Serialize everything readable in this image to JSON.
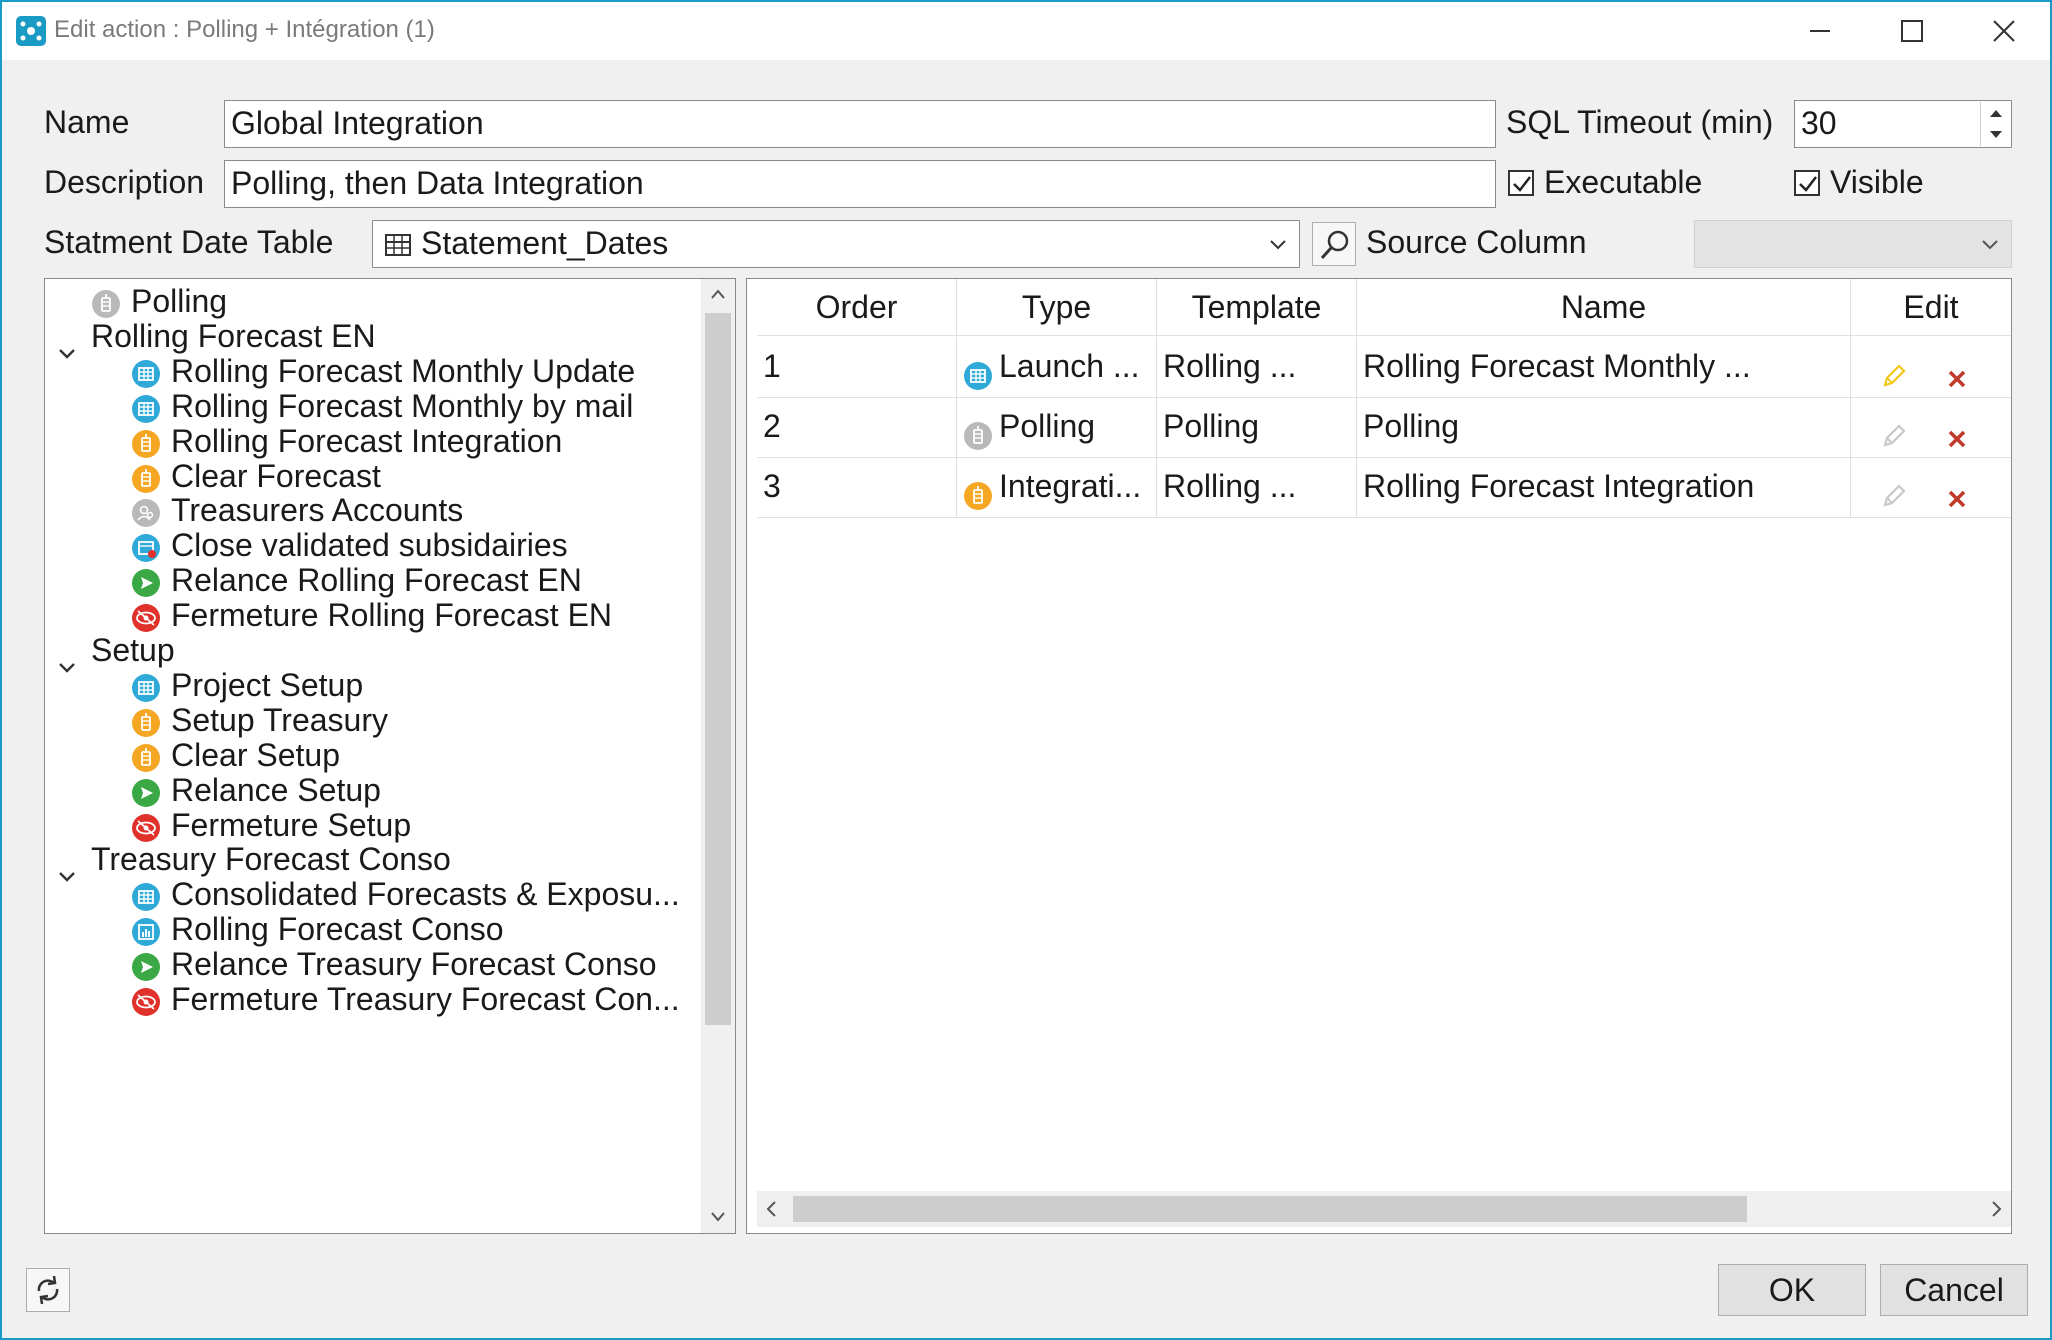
{
  "window": {
    "title": "Edit action : Polling + Intégration (1)"
  },
  "form": {
    "name_label": "Name",
    "name_value": "Global Integration",
    "sql_timeout_label": "SQL Timeout (min)",
    "sql_timeout_value": "30",
    "description_label": "Description",
    "description_value": "Polling, then Data Integration",
    "executable_label": "Executable",
    "executable_checked": true,
    "visible_label": "Visible",
    "visible_checked": true,
    "statement_date_table_label": "Statment Date Table",
    "statement_date_table_value": "Statement_Dates",
    "source_column_label": "Source Column",
    "source_column_value": ""
  },
  "tree": {
    "items": [
      {
        "label": "Polling",
        "icon": "polling-icon",
        "level": 0
      },
      {
        "label": "Rolling Forecast EN",
        "icon": "chevron-down-icon",
        "level": 0
      },
      {
        "label": "Rolling Forecast Monthly Update",
        "icon": "grid-launch-icon",
        "level": 1
      },
      {
        "label": "Rolling Forecast Monthly by mail",
        "icon": "grid-launch-icon",
        "level": 1
      },
      {
        "label": "Rolling Forecast Integration",
        "icon": "integration-icon",
        "level": 1
      },
      {
        "label": "Clear Forecast",
        "icon": "integration-icon",
        "level": 1
      },
      {
        "label": "Treasurers Accounts",
        "icon": "users-icon",
        "level": 1
      },
      {
        "label": "Close validated subsidairies",
        "icon": "close-validated-icon",
        "level": 1
      },
      {
        "label": "Relance Rolling Forecast EN",
        "icon": "send-icon",
        "level": 1
      },
      {
        "label": "Fermeture Rolling Forecast EN",
        "icon": "eye-close-icon",
        "level": 1
      },
      {
        "label": "Setup",
        "icon": "chevron-down-icon",
        "level": 0
      },
      {
        "label": "Project Setup",
        "icon": "grid-launch-icon",
        "level": 1
      },
      {
        "label": "Setup Treasury",
        "icon": "integration-icon",
        "level": 1
      },
      {
        "label": "Clear Setup",
        "icon": "integration-icon",
        "level": 1
      },
      {
        "label": "Relance Setup",
        "icon": "send-icon",
        "level": 1
      },
      {
        "label": "Fermeture Setup",
        "icon": "eye-close-icon",
        "level": 1
      },
      {
        "label": "Treasury Forecast Conso",
        "icon": "chevron-down-icon",
        "level": 0
      },
      {
        "label": "Consolidated Forecasts & Exposu...",
        "icon": "grid-launch-icon",
        "level": 1
      },
      {
        "label": "Rolling Forecast Conso",
        "icon": "report-icon",
        "level": 1
      },
      {
        "label": "Relance Treasury Forecast Conso",
        "icon": "send-icon",
        "level": 1
      },
      {
        "label": "Fermeture Treasury Forecast Con...",
        "icon": "eye-close-icon",
        "level": 1
      }
    ]
  },
  "grid": {
    "headers": [
      "Order",
      "Type",
      "Template",
      "Name",
      "Edit"
    ],
    "rows": [
      {
        "order": "1",
        "type": "Launch ...",
        "type_icon": "grid-launch-icon",
        "template": "Rolling ...",
        "name": "Rolling Forecast Monthly ...",
        "edit_enabled": true
      },
      {
        "order": "2",
        "type": "Polling",
        "type_icon": "polling-icon",
        "template": "Polling",
        "name": "Polling",
        "edit_enabled": false
      },
      {
        "order": "3",
        "type": "Integrati...",
        "type_icon": "integration-icon",
        "template": "Rolling ...",
        "name": "Rolling Forecast Integration",
        "edit_enabled": false
      }
    ]
  },
  "buttons": {
    "ok": "OK",
    "cancel": "Cancel"
  },
  "colors": {
    "accent": "#1a9bc4",
    "launch": "#2ea9d8",
    "integration": "#f5a623",
    "send": "#3aa845",
    "close": "#e0312b",
    "polling": "#b9b9b9",
    "delete": "#c0392b",
    "edit_enabled": "#f2c81a"
  }
}
